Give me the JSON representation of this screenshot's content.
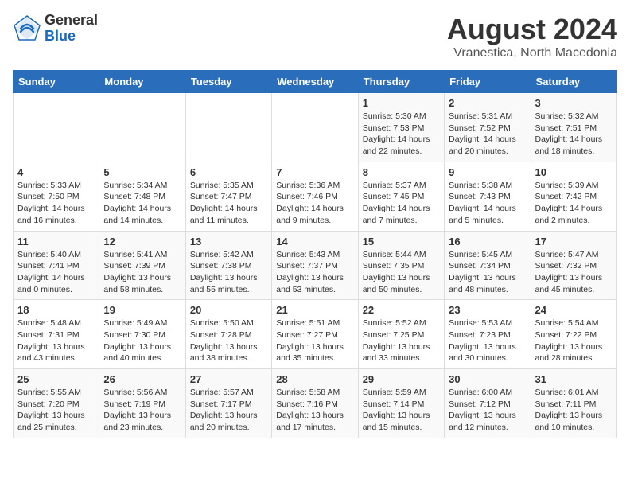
{
  "header": {
    "logo_general": "General",
    "logo_blue": "Blue",
    "main_title": "August 2024",
    "subtitle": "Vranestica, North Macedonia"
  },
  "days_of_week": [
    "Sunday",
    "Monday",
    "Tuesday",
    "Wednesday",
    "Thursday",
    "Friday",
    "Saturday"
  ],
  "weeks": [
    [
      {
        "day": "",
        "info": ""
      },
      {
        "day": "",
        "info": ""
      },
      {
        "day": "",
        "info": ""
      },
      {
        "day": "",
        "info": ""
      },
      {
        "day": "1",
        "info": "Sunrise: 5:30 AM\nSunset: 7:53 PM\nDaylight: 14 hours\nand 22 minutes."
      },
      {
        "day": "2",
        "info": "Sunrise: 5:31 AM\nSunset: 7:52 PM\nDaylight: 14 hours\nand 20 minutes."
      },
      {
        "day": "3",
        "info": "Sunrise: 5:32 AM\nSunset: 7:51 PM\nDaylight: 14 hours\nand 18 minutes."
      }
    ],
    [
      {
        "day": "4",
        "info": "Sunrise: 5:33 AM\nSunset: 7:50 PM\nDaylight: 14 hours\nand 16 minutes."
      },
      {
        "day": "5",
        "info": "Sunrise: 5:34 AM\nSunset: 7:48 PM\nDaylight: 14 hours\nand 14 minutes."
      },
      {
        "day": "6",
        "info": "Sunrise: 5:35 AM\nSunset: 7:47 PM\nDaylight: 14 hours\nand 11 minutes."
      },
      {
        "day": "7",
        "info": "Sunrise: 5:36 AM\nSunset: 7:46 PM\nDaylight: 14 hours\nand 9 minutes."
      },
      {
        "day": "8",
        "info": "Sunrise: 5:37 AM\nSunset: 7:45 PM\nDaylight: 14 hours\nand 7 minutes."
      },
      {
        "day": "9",
        "info": "Sunrise: 5:38 AM\nSunset: 7:43 PM\nDaylight: 14 hours\nand 5 minutes."
      },
      {
        "day": "10",
        "info": "Sunrise: 5:39 AM\nSunset: 7:42 PM\nDaylight: 14 hours\nand 2 minutes."
      }
    ],
    [
      {
        "day": "11",
        "info": "Sunrise: 5:40 AM\nSunset: 7:41 PM\nDaylight: 14 hours\nand 0 minutes."
      },
      {
        "day": "12",
        "info": "Sunrise: 5:41 AM\nSunset: 7:39 PM\nDaylight: 13 hours\nand 58 minutes."
      },
      {
        "day": "13",
        "info": "Sunrise: 5:42 AM\nSunset: 7:38 PM\nDaylight: 13 hours\nand 55 minutes."
      },
      {
        "day": "14",
        "info": "Sunrise: 5:43 AM\nSunset: 7:37 PM\nDaylight: 13 hours\nand 53 minutes."
      },
      {
        "day": "15",
        "info": "Sunrise: 5:44 AM\nSunset: 7:35 PM\nDaylight: 13 hours\nand 50 minutes."
      },
      {
        "day": "16",
        "info": "Sunrise: 5:45 AM\nSunset: 7:34 PM\nDaylight: 13 hours\nand 48 minutes."
      },
      {
        "day": "17",
        "info": "Sunrise: 5:47 AM\nSunset: 7:32 PM\nDaylight: 13 hours\nand 45 minutes."
      }
    ],
    [
      {
        "day": "18",
        "info": "Sunrise: 5:48 AM\nSunset: 7:31 PM\nDaylight: 13 hours\nand 43 minutes."
      },
      {
        "day": "19",
        "info": "Sunrise: 5:49 AM\nSunset: 7:30 PM\nDaylight: 13 hours\nand 40 minutes."
      },
      {
        "day": "20",
        "info": "Sunrise: 5:50 AM\nSunset: 7:28 PM\nDaylight: 13 hours\nand 38 minutes."
      },
      {
        "day": "21",
        "info": "Sunrise: 5:51 AM\nSunset: 7:27 PM\nDaylight: 13 hours\nand 35 minutes."
      },
      {
        "day": "22",
        "info": "Sunrise: 5:52 AM\nSunset: 7:25 PM\nDaylight: 13 hours\nand 33 minutes."
      },
      {
        "day": "23",
        "info": "Sunrise: 5:53 AM\nSunset: 7:23 PM\nDaylight: 13 hours\nand 30 minutes."
      },
      {
        "day": "24",
        "info": "Sunrise: 5:54 AM\nSunset: 7:22 PM\nDaylight: 13 hours\nand 28 minutes."
      }
    ],
    [
      {
        "day": "25",
        "info": "Sunrise: 5:55 AM\nSunset: 7:20 PM\nDaylight: 13 hours\nand 25 minutes."
      },
      {
        "day": "26",
        "info": "Sunrise: 5:56 AM\nSunset: 7:19 PM\nDaylight: 13 hours\nand 23 minutes."
      },
      {
        "day": "27",
        "info": "Sunrise: 5:57 AM\nSunset: 7:17 PM\nDaylight: 13 hours\nand 20 minutes."
      },
      {
        "day": "28",
        "info": "Sunrise: 5:58 AM\nSunset: 7:16 PM\nDaylight: 13 hours\nand 17 minutes."
      },
      {
        "day": "29",
        "info": "Sunrise: 5:59 AM\nSunset: 7:14 PM\nDaylight: 13 hours\nand 15 minutes."
      },
      {
        "day": "30",
        "info": "Sunrise: 6:00 AM\nSunset: 7:12 PM\nDaylight: 13 hours\nand 12 minutes."
      },
      {
        "day": "31",
        "info": "Sunrise: 6:01 AM\nSunset: 7:11 PM\nDaylight: 13 hours\nand 10 minutes."
      }
    ]
  ]
}
